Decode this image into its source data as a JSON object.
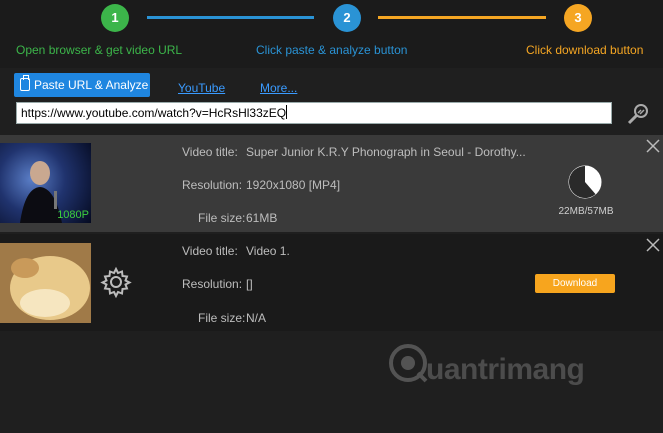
{
  "steps": [
    {
      "number": "1",
      "label": "Open browser & get video URL",
      "color": "#3cb54a"
    },
    {
      "number": "2",
      "label": "Click paste & analyze button",
      "color": "#2a93d5"
    },
    {
      "number": "3",
      "label": "Click download button",
      "color": "#f5a623"
    }
  ],
  "toolbar": {
    "paste_label": "Paste URL & Analyze",
    "youtube_link": "YouTube",
    "more_link": "More...",
    "url_value": "https://www.youtube.com/watch?v=HcRsHl33zEQ"
  },
  "videos": [
    {
      "title_label": "Video title:",
      "title": "Super Junior K.R.Y Phonograph in Seoul - Dorothy...",
      "resolution_label": "Resolution:",
      "resolution": "1920x1080 [MP4]",
      "size_label": "File size:",
      "size": "61MB",
      "quality_badge": "1080P",
      "progress_text": "22MB/57MB",
      "progress_fraction": 0.386
    },
    {
      "title_label": "Video title:",
      "title": "Video 1.",
      "resolution_label": "Resolution:",
      "resolution": "[]",
      "size_label": "File size:",
      "size": "N/A",
      "download_label": "Download"
    }
  ],
  "watermark": {
    "text": "uantrimang"
  }
}
